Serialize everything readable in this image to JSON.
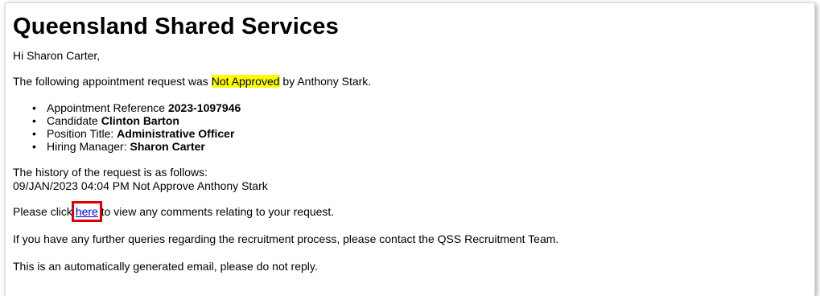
{
  "email": {
    "heading": "Queensland Shared Services",
    "greeting": "Hi Sharon Carter,",
    "intro_prefix": "The following appointment request was ",
    "status": "Not Approved",
    "intro_suffix": " by Anthony Stark.",
    "details": [
      {
        "label": "Appointment Reference ",
        "value": "2023-1097946"
      },
      {
        "label": "Candidate ",
        "value": "Clinton Barton"
      },
      {
        "label": "Position Title: ",
        "value": "Administrative Officer"
      },
      {
        "label": "Hiring Manager: ",
        "value": "Sharon Carter"
      }
    ],
    "history_heading": "The history of the request is as follows:",
    "history_entry": "09/JAN/2023 04:04 PM Not Approve Anthony Stark",
    "click_prefix": "Please click ",
    "click_link": "here",
    "click_suffix": " to view any comments relating to your request.",
    "queries": "If you have any further queries regarding the recruitment process, please contact the QSS Recruitment Team.",
    "auto_notice": "This is an automatically generated email, please do not reply."
  },
  "colors": {
    "highlight": "#ffff00",
    "link": "#0000ee",
    "annotation_box": "#e00000"
  }
}
